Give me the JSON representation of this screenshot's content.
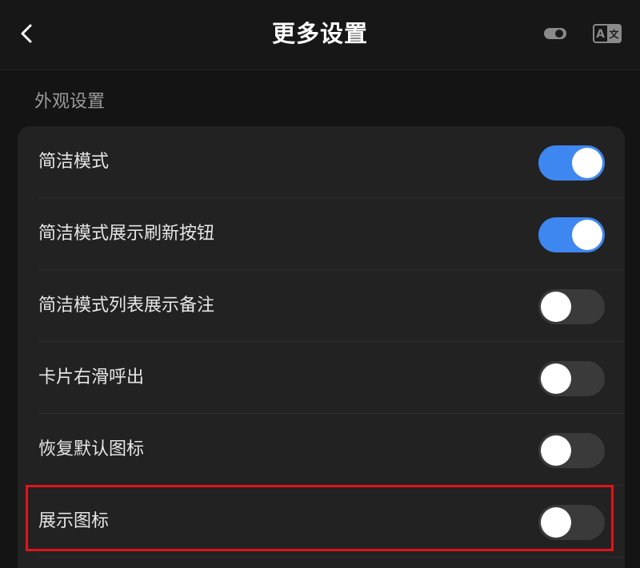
{
  "header": {
    "title": "更多设置",
    "back_icon": "chevron-left-icon",
    "theme_icon": "toggle-icon",
    "translate_icon": "translate-icon",
    "translate_glyph_left": "A",
    "translate_glyph_right": "文"
  },
  "section": {
    "title": "外观设置"
  },
  "settings": [
    {
      "label": "简洁模式",
      "enabled": true
    },
    {
      "label": "简洁模式展示刷新按钮",
      "enabled": true
    },
    {
      "label": "简洁模式列表展示备注",
      "enabled": false
    },
    {
      "label": "卡片右滑呼出",
      "enabled": false
    },
    {
      "label": "恢复默认图标",
      "enabled": false
    },
    {
      "label": "展示图标",
      "enabled": false
    }
  ],
  "colors": {
    "switch_on": "#3f87f0",
    "switch_off": "#3a3a3a",
    "highlight": "#e0141a"
  }
}
